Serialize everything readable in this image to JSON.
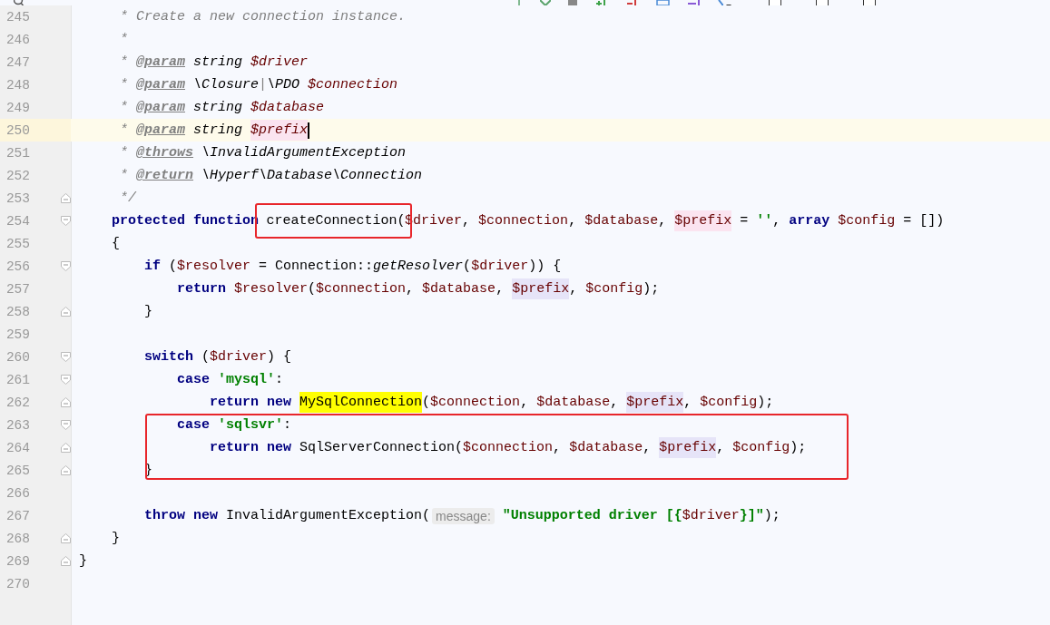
{
  "find_bar": {
    "options": [
      {
        "checked": false
      },
      {
        "checked": false
      },
      {
        "checked": false
      }
    ]
  },
  "lines": [
    {
      "number": "245",
      "tokens": [
        {
          "kind": "doc",
          "text": "     * Create a new connection instance."
        }
      ]
    },
    {
      "number": "246",
      "tokens": [
        {
          "kind": "doc",
          "text": "     *"
        }
      ]
    },
    {
      "number": "247",
      "tokens": [
        {
          "kind": "doc",
          "text": "     * "
        },
        {
          "kind": "tag",
          "text": "@param"
        },
        {
          "kind": "doctype",
          "text": " string "
        },
        {
          "kind": "docvar",
          "text": "$driver"
        }
      ]
    },
    {
      "number": "248",
      "tokens": [
        {
          "kind": "doc",
          "text": "     * "
        },
        {
          "kind": "tag",
          "text": "@param"
        },
        {
          "kind": "doctype",
          "text": " \\Closure"
        },
        {
          "kind": "doc",
          "text": "|"
        },
        {
          "kind": "doctype",
          "text": "\\PDO "
        },
        {
          "kind": "docvar",
          "text": "$connection"
        }
      ]
    },
    {
      "number": "249",
      "tokens": [
        {
          "kind": "doc",
          "text": "     * "
        },
        {
          "kind": "tag",
          "text": "@param"
        },
        {
          "kind": "doctype",
          "text": " string "
        },
        {
          "kind": "docvar",
          "text": "$database"
        }
      ]
    },
    {
      "number": "250",
      "current": true,
      "caret": true,
      "tokens": [
        {
          "kind": "doc",
          "text": "     * "
        },
        {
          "kind": "tag",
          "text": "@param"
        },
        {
          "kind": "doctype",
          "text": " string "
        },
        {
          "kind": "docvar",
          "text": "$prefix",
          "color": "#fbe4f0"
        }
      ]
    },
    {
      "number": "251",
      "tokens": [
        {
          "kind": "doc",
          "text": "     * "
        },
        {
          "kind": "tag",
          "text": "@throws"
        },
        {
          "kind": "doctype",
          "text": " \\InvalidArgumentException"
        }
      ]
    },
    {
      "number": "252",
      "tokens": [
        {
          "kind": "doc",
          "text": "     * "
        },
        {
          "kind": "tag",
          "text": "@return"
        },
        {
          "kind": "doctype",
          "text": " \\Hyperf\\Database\\Connection"
        }
      ]
    },
    {
      "number": "253",
      "fold_end": true,
      "tokens": [
        {
          "kind": "doc",
          "text": "     */"
        }
      ]
    },
    {
      "number": "254",
      "fold_start": true,
      "tokens": [
        {
          "kind": "kw",
          "text": "    protected function "
        },
        {
          "kind": "plain",
          "text": "createConnection(",
          "boxed": true
        },
        {
          "kind": "var",
          "text": "$driver"
        },
        {
          "kind": "plain",
          "text": ", "
        },
        {
          "kind": "var",
          "text": "$connection"
        },
        {
          "kind": "plain",
          "text": ", "
        },
        {
          "kind": "var",
          "text": "$database"
        },
        {
          "kind": "plain",
          "text": ", "
        },
        {
          "kind": "var",
          "text": "$prefix",
          "color": "#fbe4f0"
        },
        {
          "kind": "plain",
          "text": " = "
        },
        {
          "kind": "str",
          "text": "''"
        },
        {
          "kind": "plain",
          "text": ", "
        },
        {
          "kind": "kw",
          "text": "array "
        },
        {
          "kind": "var",
          "text": "$config"
        },
        {
          "kind": "plain",
          "text": " = [])"
        }
      ]
    },
    {
      "number": "255",
      "tokens": [
        {
          "kind": "plain",
          "text": "    {"
        }
      ]
    },
    {
      "number": "256",
      "fold_start": true,
      "tokens": [
        {
          "kind": "kw",
          "text": "        if"
        },
        {
          "kind": "plain",
          "text": " ("
        },
        {
          "kind": "var",
          "text": "$resolver"
        },
        {
          "kind": "plain",
          "text": " = Connection::"
        },
        {
          "kind": "call",
          "text": "getResolver"
        },
        {
          "kind": "plain",
          "text": "("
        },
        {
          "kind": "var",
          "text": "$driver"
        },
        {
          "kind": "plain",
          "text": ")) {"
        }
      ]
    },
    {
      "number": "257",
      "tokens": [
        {
          "kind": "kw",
          "text": "            return "
        },
        {
          "kind": "var",
          "text": "$resolver"
        },
        {
          "kind": "plain",
          "text": "("
        },
        {
          "kind": "var",
          "text": "$connection"
        },
        {
          "kind": "plain",
          "text": ", "
        },
        {
          "kind": "var",
          "text": "$database"
        },
        {
          "kind": "plain",
          "text": ", "
        },
        {
          "kind": "var",
          "text": "$prefix",
          "color": "#e6e4f8"
        },
        {
          "kind": "plain",
          "text": ", "
        },
        {
          "kind": "var",
          "text": "$config"
        },
        {
          "kind": "plain",
          "text": ");"
        }
      ]
    },
    {
      "number": "258",
      "fold_end": true,
      "tokens": [
        {
          "kind": "plain",
          "text": "        }"
        }
      ]
    },
    {
      "number": "259"
    },
    {
      "number": "260",
      "fold_start": true,
      "tokens": [
        {
          "kind": "kw",
          "text": "        switch"
        },
        {
          "kind": "plain",
          "text": " ("
        },
        {
          "kind": "var",
          "text": "$driver"
        },
        {
          "kind": "plain",
          "text": ") {"
        }
      ]
    },
    {
      "number": "261",
      "fold_start": true,
      "tokens": [
        {
          "kind": "kw",
          "text": "            case "
        },
        {
          "kind": "str",
          "text": "'mysql'"
        },
        {
          "kind": "plain",
          "text": ":"
        }
      ]
    },
    {
      "number": "262",
      "fold_end": true,
      "tokens": [
        {
          "kind": "kw",
          "text": "                return new "
        },
        {
          "kind": "plain",
          "text": "MySqlConnection",
          "color": "#ffff00"
        },
        {
          "kind": "plain",
          "text": "("
        },
        {
          "kind": "var",
          "text": "$connection"
        },
        {
          "kind": "plain",
          "text": ", "
        },
        {
          "kind": "var",
          "text": "$database"
        },
        {
          "kind": "plain",
          "text": ", "
        },
        {
          "kind": "var",
          "text": "$prefix",
          "color": "#e6e4f8"
        },
        {
          "kind": "plain",
          "text": ", "
        },
        {
          "kind": "var",
          "text": "$config"
        },
        {
          "kind": "plain",
          "text": ");"
        }
      ]
    },
    {
      "number": "263",
      "fold_start": true,
      "in_box": true,
      "tokens": [
        {
          "kind": "kw",
          "text": "            case "
        },
        {
          "kind": "str",
          "text": "'sqlsvr'"
        },
        {
          "kind": "plain",
          "text": ":"
        }
      ]
    },
    {
      "number": "264",
      "fold_end": true,
      "in_box": true,
      "tokens": [
        {
          "kind": "kw",
          "text": "                return new "
        },
        {
          "kind": "plain",
          "text": "SqlServerConnection("
        },
        {
          "kind": "var",
          "text": "$connection"
        },
        {
          "kind": "plain",
          "text": ", "
        },
        {
          "kind": "var",
          "text": "$database"
        },
        {
          "kind": "plain",
          "text": ", "
        },
        {
          "kind": "var",
          "text": "$prefix",
          "color": "#e6e4f8"
        },
        {
          "kind": "plain",
          "text": ", "
        },
        {
          "kind": "var",
          "text": "$config"
        },
        {
          "kind": "plain",
          "text": ");"
        }
      ]
    },
    {
      "number": "265",
      "fold_end": true,
      "in_box": true,
      "tokens": [
        {
          "kind": "plain",
          "text": "        }"
        }
      ]
    },
    {
      "number": "266"
    },
    {
      "number": "267",
      "tokens": [
        {
          "kind": "kw",
          "text": "        throw new "
        },
        {
          "kind": "plain",
          "text": "InvalidArgumentException("
        },
        {
          "kind": "hint",
          "text": "message:"
        },
        {
          "kind": "str",
          "text": " \"Unsupported driver [{"
        },
        {
          "kind": "var",
          "text": "$driver"
        },
        {
          "kind": "str",
          "text": "}]\""
        },
        {
          "kind": "plain",
          "text": ");"
        }
      ]
    },
    {
      "number": "268",
      "fold_end": true,
      "tokens": [
        {
          "kind": "plain",
          "text": "    }"
        }
      ]
    },
    {
      "number": "269",
      "fold_end": true,
      "tokens": [
        {
          "kind": "plain",
          "text": "}"
        }
      ]
    },
    {
      "number": "270"
    }
  ]
}
